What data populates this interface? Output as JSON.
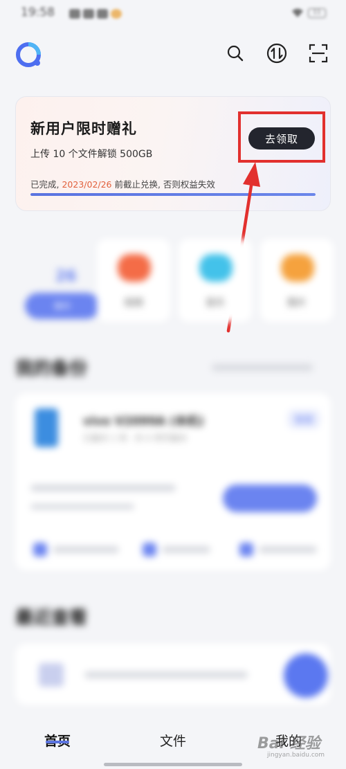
{
  "status_bar": {
    "time": "19:58",
    "battery": "11"
  },
  "promo": {
    "title": "新用户限时赠礼",
    "subtitle": "上传 10 个文件解锁 500GB",
    "status_prefix": "已完成,",
    "deadline_date": "2023/02/26",
    "status_suffix": " 前截止兑换, 否则权益失效",
    "claim_label": "去领取",
    "progress_fraction": 1.0
  },
  "quick_actions": {
    "backup_count": "26",
    "items": [
      "备份",
      "视频",
      "音乐",
      "图片"
    ]
  },
  "sections": {
    "my_backup": "我的备份",
    "recent": "最近查看"
  },
  "device": {
    "name": "vivo V2099A (本机)",
    "subtitle": "已备份 1 项 · 共 4 项可备份",
    "tag": "管理"
  },
  "bottom_nav": {
    "items": [
      "首页",
      "文件",
      "我的"
    ],
    "active_index": 0
  },
  "watermark": {
    "text": "Bai 经验",
    "sub": "jingyan.baidu.com"
  },
  "colors": {
    "accent": "#5a73e0",
    "highlight": "#e2302e",
    "deadline": "#e2603c",
    "claim_button_bg": "#23252e"
  }
}
